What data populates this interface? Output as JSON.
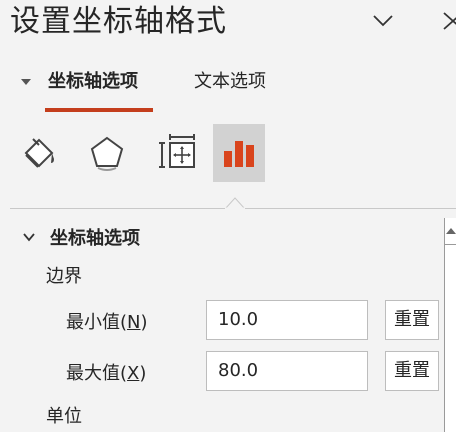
{
  "pane": {
    "title": "设置坐标轴格式"
  },
  "tabs": [
    {
      "label": "坐标轴选项",
      "active": true
    },
    {
      "label": "文本选项",
      "active": false
    }
  ],
  "icons": [
    "fill-line-icon",
    "effects-icon",
    "size-properties-icon",
    "axis-options-icon"
  ],
  "section": {
    "title": "坐标轴选项",
    "bounds_label": "边界",
    "min": {
      "label": "最小值(",
      "accel": "N",
      "label_end": ")",
      "value": "10.0",
      "reset": "重置"
    },
    "max": {
      "label": "最大值(",
      "accel": "X",
      "label_end": ")",
      "value": "80.0",
      "reset": "重置"
    },
    "units_label": "单位"
  },
  "colors": {
    "accent": "#c43e1c",
    "fill_icon": "#d9441c",
    "background": "#f3f3f3"
  }
}
